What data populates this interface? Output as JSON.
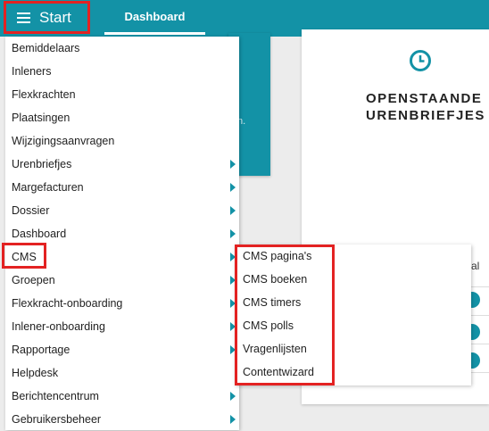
{
  "topbar": {
    "start_label": "Start",
    "tab_dashboard": "Dashboard"
  },
  "background": {
    "teal_card_text": "n.",
    "card_title_line1": "OPENSTAANDE",
    "card_title_line2": "URENBRIEFJES",
    "partial_column_text": "al"
  },
  "menu": {
    "items": [
      {
        "label": "Bemiddelaars",
        "has_submenu": false
      },
      {
        "label": "Inleners",
        "has_submenu": false
      },
      {
        "label": "Flexkrachten",
        "has_submenu": false
      },
      {
        "label": "Plaatsingen",
        "has_submenu": false
      },
      {
        "label": "Wijzigingsaanvragen",
        "has_submenu": false
      },
      {
        "label": "Urenbriefjes",
        "has_submenu": true
      },
      {
        "label": "Margefacturen",
        "has_submenu": true
      },
      {
        "label": "Dossier",
        "has_submenu": true
      },
      {
        "label": "Dashboard",
        "has_submenu": true
      },
      {
        "label": "CMS",
        "has_submenu": true
      },
      {
        "label": "Groepen",
        "has_submenu": true
      },
      {
        "label": "Flexkracht-onboarding",
        "has_submenu": true
      },
      {
        "label": "Inlener-onboarding",
        "has_submenu": true
      },
      {
        "label": "Rapportage",
        "has_submenu": true
      },
      {
        "label": "Helpdesk",
        "has_submenu": false
      },
      {
        "label": "Berichtencentrum",
        "has_submenu": true
      },
      {
        "label": "Gebruikersbeheer",
        "has_submenu": true
      }
    ]
  },
  "submenu": {
    "items": [
      {
        "label": "CMS pagina's"
      },
      {
        "label": "CMS boeken"
      },
      {
        "label": "CMS timers"
      },
      {
        "label": "CMS polls"
      },
      {
        "label": "Vragenlijsten"
      },
      {
        "label": "Contentwizard"
      }
    ]
  },
  "colors": {
    "accent": "#1392a6",
    "highlight": "#e32222"
  }
}
